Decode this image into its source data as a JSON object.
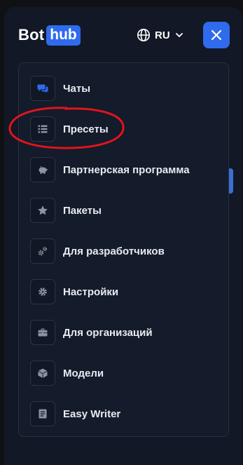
{
  "header": {
    "logo_left": "Bot",
    "logo_right": "hub",
    "language": "RU",
    "close_label": "✕"
  },
  "menu": {
    "items": [
      {
        "label": "Чаты",
        "icon": "chat-icon"
      },
      {
        "label": "Пресеты",
        "icon": "list-icon"
      },
      {
        "label": "Партнерская программа",
        "icon": "piggy-bank-icon"
      },
      {
        "label": "Пакеты",
        "icon": "star-icon"
      },
      {
        "label": "Для разработчиков",
        "icon": "gears-icon"
      },
      {
        "label": "Настройки",
        "icon": "gear-icon"
      },
      {
        "label": "Для организаций",
        "icon": "briefcase-icon"
      },
      {
        "label": "Модели",
        "icon": "cube-icon"
      },
      {
        "label": "Easy Writer",
        "icon": "document-icon"
      }
    ]
  },
  "colors": {
    "background": "#121826",
    "accent": "#2f6bec",
    "annotation": "#e0141e"
  }
}
